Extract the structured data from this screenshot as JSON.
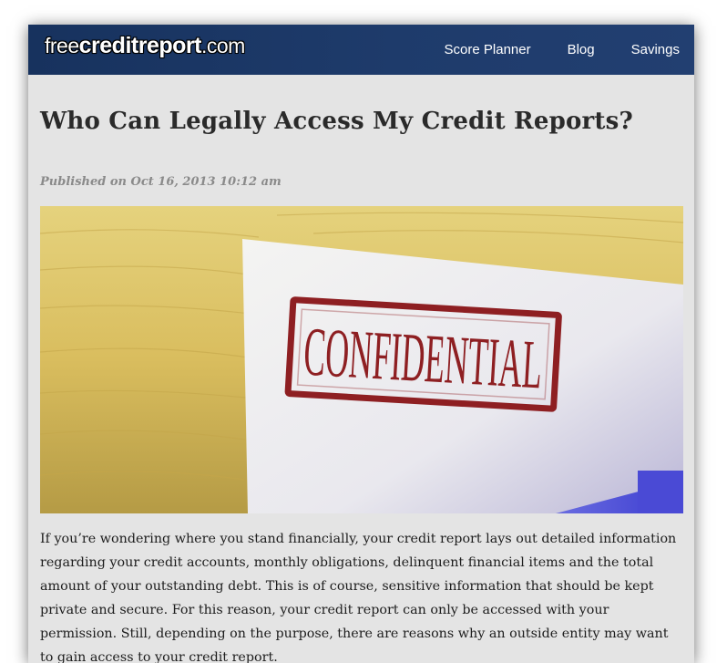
{
  "header": {
    "logo": {
      "prefix": "free",
      "middle": "creditreport",
      "suffix": ".com"
    },
    "nav": [
      "Score Planner",
      "Blog",
      "Savings"
    ]
  },
  "article": {
    "title": "Who Can Legally Access My Credit Reports?",
    "published": "Published on Oct 16, 2013 10:12 am",
    "image_text": "CONFIDENTIAL",
    "body": "If you’re wondering where you stand financially, your credit report lays out detailed information regarding your credit accounts, monthly obligations, delinquent financial items and the total amount of your outstanding debt. This is of course, sensitive information that should be kept private and secure. For this reason, your credit report can only be accessed with your permission. Still, depending on the purpose, there are reasons why an outside entity may want to gain access to your credit report."
  },
  "colors": {
    "header_bg": "#1b3665",
    "stamp_red": "#8e1f22",
    "page_bg": "#e4e4e4"
  }
}
